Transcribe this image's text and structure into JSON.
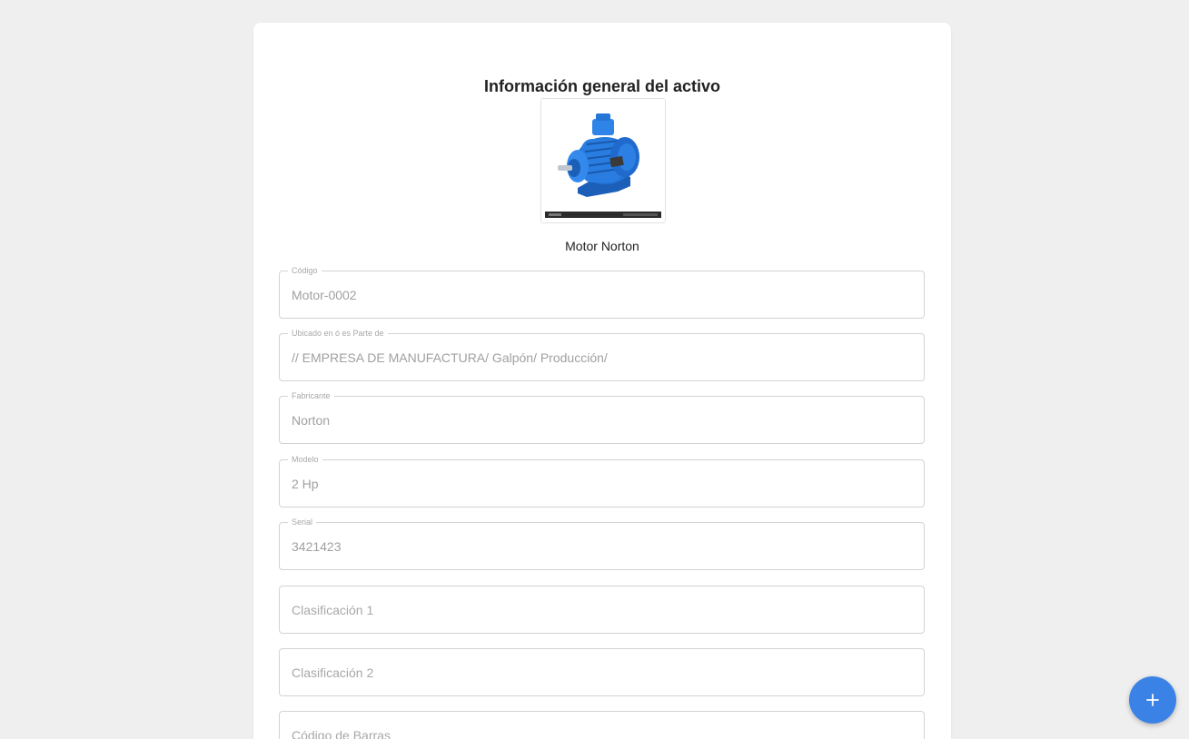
{
  "card": {
    "title": "Información general del activo",
    "asset_name": "Motor Norton"
  },
  "fields": [
    {
      "label": "Código",
      "value": "Motor-0002",
      "placeholder": ""
    },
    {
      "label": "Ubicado en ó es Parte de",
      "value": "// EMPRESA DE MANUFACTURA/ Galpón/ Producción/",
      "placeholder": ""
    },
    {
      "label": "Fabricante",
      "value": "Norton",
      "placeholder": ""
    },
    {
      "label": "Modelo",
      "value": "2 Hp",
      "placeholder": ""
    },
    {
      "label": "Serial",
      "value": "3421423",
      "placeholder": ""
    },
    {
      "label": "",
      "value": "",
      "placeholder": "Clasificación 1"
    },
    {
      "label": "",
      "value": "",
      "placeholder": "Clasificación 2"
    },
    {
      "label": "",
      "value": "",
      "placeholder": "Código de Barras"
    }
  ],
  "fab": {
    "icon": "plus-icon",
    "color": "#3b82e6"
  },
  "colors": {
    "background": "#efefef",
    "card": "#ffffff",
    "motor_blue": "#1f6fd1"
  }
}
